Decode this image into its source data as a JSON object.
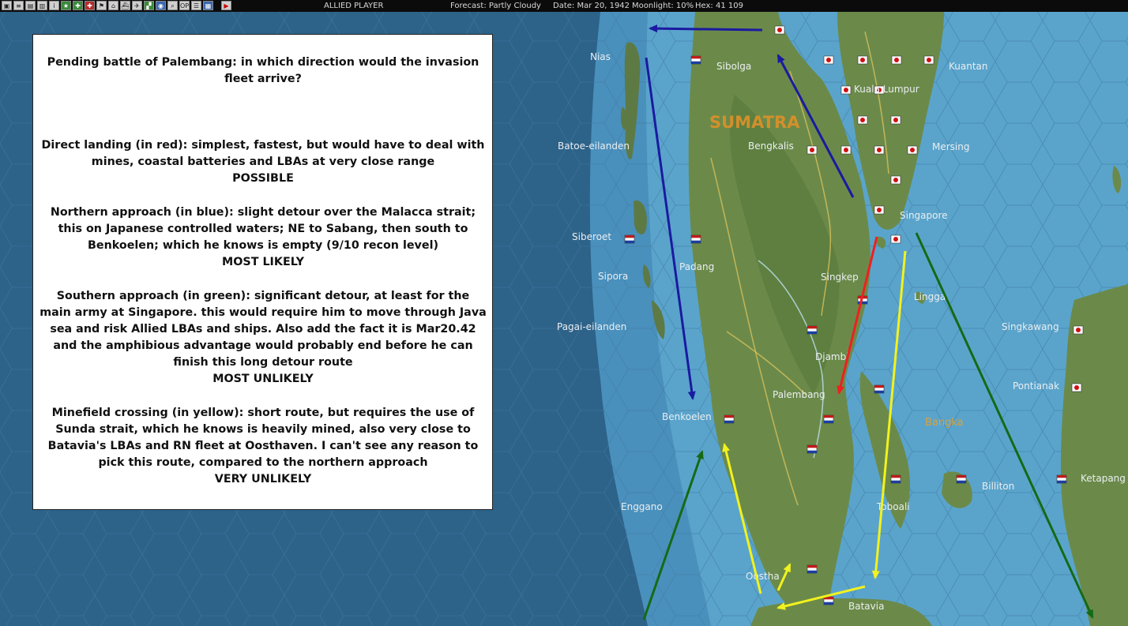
{
  "toolbar": {
    "player": "ALLIED PLAYER",
    "forecast": "Forecast: Partly Cloudy",
    "date": "Date: Mar 20, 1942",
    "moonlight": "Moonlight: 10%",
    "hex": "Hex: 41  109",
    "icons": [
      "save-icon",
      "doc-icon",
      "report-icon",
      "report-icon",
      "info-icon",
      "star-icon",
      "ground-icon",
      "hq-icon",
      "flag-icon",
      "base-icon",
      "ship-icon",
      "air-icon",
      "convoy-icon",
      "globe-icon",
      "search-icon",
      "op-icon",
      "list-icon",
      "chart-icon",
      "end-turn-icon"
    ],
    "op_label": "OP"
  },
  "note": {
    "title": "Pending battle of Palembang: in which direction would the invasion fleet arrive?",
    "direct": {
      "text": "Direct landing (in red): simplest, fastest, but would have to deal with mines, coastal batteries and LBAs at very close range",
      "verdict": "POSSIBLE"
    },
    "northern": {
      "text": "Northern approach (in blue): slight detour over the Malacca strait; this on Japanese controlled waters; NE to Sabang, then south to Benkoelen; which he knows is empty (9/10 recon level)",
      "verdict": "MOST LIKELY"
    },
    "southern": {
      "text": "Southern approach (in green): significant detour, at least for the main army at Singapore. this would require him to move through Java sea and risk Allied LBAs and ships. Also add the fact it is Mar20.42 and the amphibious advantage would probably end before he can finish this long detour route",
      "verdict": "MOST UNLIKELY"
    },
    "minefield": {
      "text": "Minefield crossing (in yellow): short route, but requires the use of Sunda strait, which he knows is heavily mined, also very close to Batavia's LBAs and RN fleet at Oosthaven. I can't see any reason to pick this route, compared to the northern approach",
      "verdict": "VERY UNLIKELY"
    }
  },
  "map": {
    "region_label": "SUMATRA",
    "sea_label": "Bangka",
    "places": {
      "nias": "Nias",
      "sibolga": "Sibolga",
      "kuala_lumpur": "Kuala Lumpur",
      "kuantan": "Kuantan",
      "batoe": "Batoe-eilanden",
      "bengkalis": "Bengkalis",
      "mersing": "Mersing",
      "singapore": "Singapore",
      "siberoet": "Siberoet",
      "padang": "Padang",
      "singkep": "Singkep",
      "sipora": "Sipora",
      "lingga": "Lingga",
      "pagai": "Pagai-eilanden",
      "singkawang": "Singkawang",
      "djambi": "Djambi",
      "palembang": "Palembang",
      "pontianak": "Pontianak",
      "benkoelen": "Benkoelen",
      "billiton": "Billiton",
      "ketapang": "Ketapang",
      "enggano": "Enggano",
      "toboali": "Toboali",
      "oosthaven": "Oostha",
      "batavia": "Batavia"
    },
    "arrow_colors": {
      "red": "#ee2020",
      "blue": "#1a1aa0",
      "green": "#156a15",
      "yellow": "#f2f21e"
    }
  }
}
